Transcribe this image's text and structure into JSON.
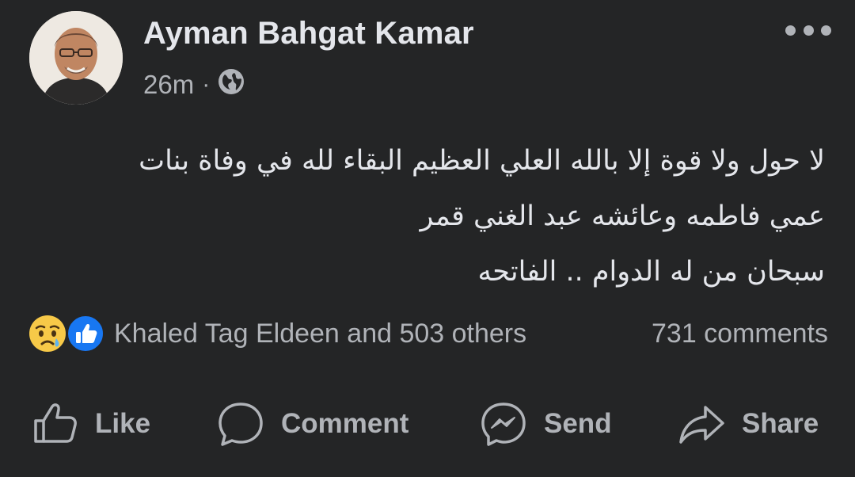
{
  "post": {
    "author": "Ayman Bahgat Kamar",
    "time": "26m",
    "separator": "·",
    "privacy_icon": "globe-icon",
    "menu_icon": "more-horizontal-icon",
    "text_lines": [
      "لا حول ولا قوة إلا بالله العلي العظيم البقاء لله في وفاة بنات",
      "عمي فاطمه وعائشه عبد الغني قمر",
      "سبحان من له الدوام .. الفاتحه"
    ]
  },
  "reactions": {
    "icons": [
      "sad-reaction-icon",
      "like-reaction-icon"
    ],
    "summary": "Khaled Tag Eldeen and 503 others",
    "comments": "731 comments"
  },
  "actions": {
    "like": "Like",
    "comment": "Comment",
    "send": "Send",
    "share": "Share"
  },
  "colors": {
    "background": "#242526",
    "primary_text": "#e4e6eb",
    "secondary_text": "#b0b3b8",
    "like_blue": "#1877f2",
    "sad_yellow": "#f7c948"
  }
}
